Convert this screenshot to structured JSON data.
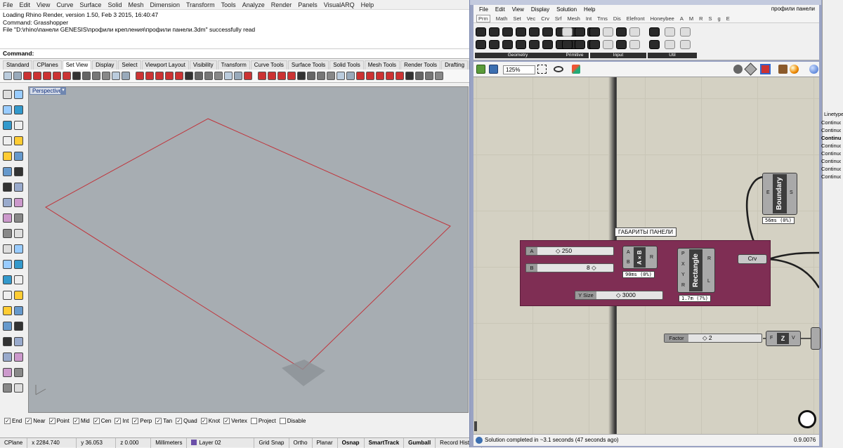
{
  "rhino": {
    "menu": [
      "File",
      "Edit",
      "View",
      "Curve",
      "Surface",
      "Solid",
      "Mesh",
      "Dimension",
      "Transform",
      "Tools",
      "Analyze",
      "Render",
      "Panels",
      "VisualARQ",
      "Help"
    ],
    "history": [
      "Loading Rhino Render, version 1.50, Feb  3 2015, 16:40:47",
      "Command: Grasshopper",
      "File \"D:\\rhino\\панели GENESIS\\профили крепления\\профили панели.3dm\" successfully read"
    ],
    "command_prompt": "Command:",
    "tabs": [
      "Standard",
      "CPlanes",
      "Set View",
      "Display",
      "Select",
      "Viewport Layout",
      "Visibility",
      "Transform",
      "Curve Tools",
      "Surface Tools",
      "Solid Tools",
      "Mesh Tools",
      "Render Tools",
      "Drafting",
      "New in V5"
    ],
    "active_tab": "Set View",
    "viewport_title": "Perspective",
    "osnaps": [
      {
        "label": "End",
        "checked": true
      },
      {
        "label": "Near",
        "checked": true
      },
      {
        "label": "Point",
        "checked": true
      },
      {
        "label": "Mid",
        "checked": true
      },
      {
        "label": "Cen",
        "checked": true
      },
      {
        "label": "Int",
        "checked": true
      },
      {
        "label": "Perp",
        "checked": true
      },
      {
        "label": "Tan",
        "checked": true
      },
      {
        "label": "Quad",
        "checked": true
      },
      {
        "label": "Knot",
        "checked": true
      },
      {
        "label": "Vertex",
        "checked": true
      },
      {
        "label": "Project",
        "checked": false
      },
      {
        "label": "Disable",
        "checked": false
      }
    ],
    "status": {
      "cplane": "CPlane",
      "x": "x 2284.740",
      "y": "y 36.053",
      "z": "z 0.000",
      "units": "Millimeters",
      "layer": "Layer 02",
      "layer_color": "#6b4fa8",
      "grid_snap": "Grid Snap",
      "ortho": "Ortho",
      "planar": "Planar",
      "osnap": "Osnap",
      "smarttrack": "SmartTrack",
      "gumball": "Gumball",
      "record_history": "Record History"
    },
    "curve_color": "#c0343b"
  },
  "gh": {
    "menu": [
      "File",
      "Edit",
      "View",
      "Display",
      "Solution",
      "Help"
    ],
    "document_name": "профили панели",
    "tabs": [
      "Prm",
      "Math",
      "Set",
      "Vec",
      "Crv",
      "Srf",
      "Mesh",
      "Int",
      "Trns",
      "Dis",
      "Elefront",
      "Honeybee",
      "A",
      "M",
      "R",
      "S",
      "g",
      "E"
    ],
    "active_tab": "Prm",
    "ribbon_groups": [
      "Geometry",
      "Primitive",
      "Input",
      "Util"
    ],
    "zoom": "125%",
    "group_label": "ГАБАРИТЫ ПАНЕЛИ",
    "group_color": "#7f2e54",
    "sliders": [
      {
        "name": "A",
        "value": "◇ 250"
      },
      {
        "name": "B",
        "value": "8 ◇"
      },
      {
        "name": "Y Size",
        "value": "◇ 3000"
      },
      {
        "name": "Factor",
        "value": "◇ 2"
      }
    ],
    "multiply": {
      "name": "A×B",
      "inputs": [
        "A",
        "B"
      ],
      "outputs": [
        "R"
      ],
      "timing": "90ms (0%)"
    },
    "rectangle": {
      "name": "Rectangle",
      "inputs": [
        "P",
        "X",
        "Y",
        "R"
      ],
      "outputs": [
        "R",
        "L"
      ],
      "timing": "1.7m (7%)"
    },
    "boundary": {
      "name": "Boundary",
      "inputs": [
        "E"
      ],
      "outputs": [
        "S"
      ],
      "timing": "56ms (0%)"
    },
    "crv": "Crv",
    "zvec": {
      "name": "Z",
      "inputs": [
        "F"
      ],
      "outputs": [
        "V"
      ]
    },
    "status_message": "Solution completed in ~3.1 seconds (47 seconds ago)",
    "version": "0.9.0076"
  },
  "layers_panel": {
    "header": "Linetype",
    "rows": [
      "Continuous",
      "Continuous",
      "Continuous",
      "Continuous",
      "Continuous",
      "Continuous",
      "Continuous",
      "Continuous"
    ],
    "bold_row": 2
  }
}
